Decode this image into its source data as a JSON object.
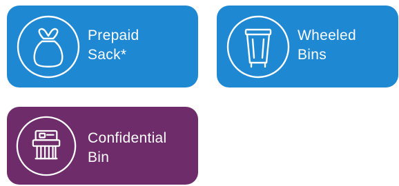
{
  "tiles": {
    "prepaid_sack": {
      "line1": "Prepaid",
      "line2": "Sack*",
      "icon": "sack-icon",
      "color": "#1e88d2"
    },
    "wheeled_bins": {
      "line1": "Wheeled",
      "line2": "Bins",
      "icon": "wheeled-bin-icon",
      "color": "#1e88d2"
    },
    "confidential_bin": {
      "line1": "Confidential",
      "line2": "Bin",
      "icon": "shredder-icon",
      "color": "#6e2c6a"
    }
  }
}
